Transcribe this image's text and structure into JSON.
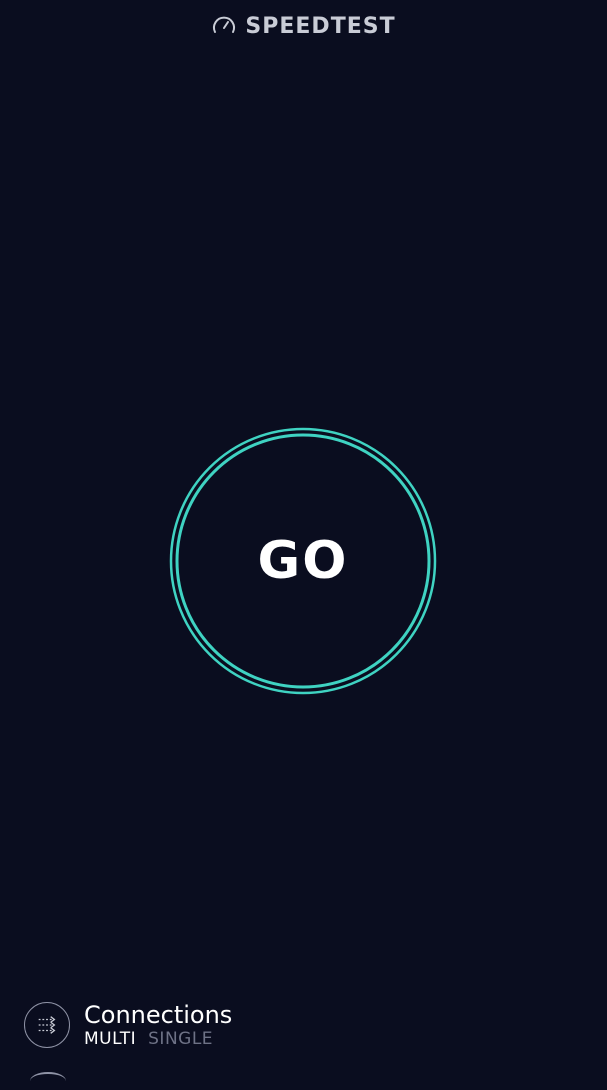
{
  "header": {
    "title": "SPEEDTEST",
    "icon": "speedometer-icon"
  },
  "main": {
    "go_label": "GO",
    "accent_color": "#3fd3c2"
  },
  "connections": {
    "icon": "multi-connections-icon",
    "title": "Connections",
    "options": [
      "MULTI",
      "SINGLE"
    ],
    "selected": "MULTI"
  },
  "colors": {
    "background": "#0a0d1f",
    "accent": "#3fd3c2",
    "inactive_text": "#6e7286"
  }
}
